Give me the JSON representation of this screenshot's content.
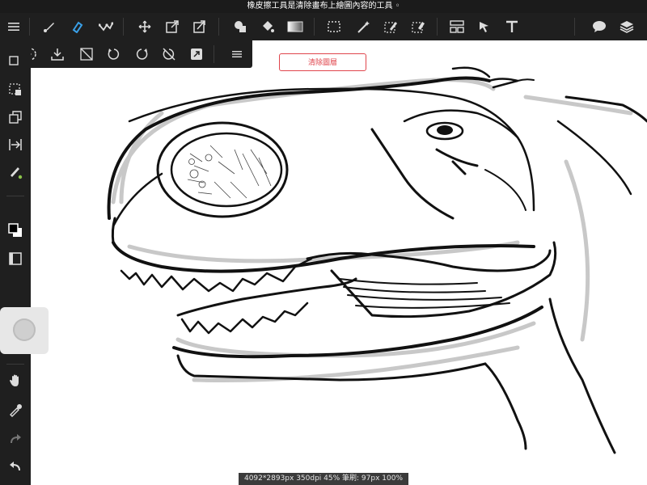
{
  "window": {
    "title": "橡皮擦工具是清除畫布上繪圖內容的工具 ◦"
  },
  "toolbar": {
    "items": [
      "menu-icon",
      "brush-icon",
      "eraser-icon",
      "stroke-icon",
      "move-icon",
      "transform-icon",
      "distort-icon",
      "shape-icon",
      "fill-icon",
      "gradient-icon",
      "rect-select-icon",
      "magic-wand-icon",
      "pen-select-icon",
      "erase-select-icon",
      "layout-icon",
      "select-arrow-icon",
      "text-icon",
      "comment-icon",
      "layers-icon"
    ],
    "active": "eraser-icon"
  },
  "subbar": {
    "items": [
      "lasso-icon",
      "import-icon",
      "flip-icon",
      "rotate-left-icon",
      "rotate-right-icon",
      "no-rotate-icon",
      "resize-icon",
      "more-icon"
    ]
  },
  "actions": {
    "clear_layer": "清除圖層"
  },
  "leftbar": {
    "items": [
      "layer-move-icon",
      "selection-icon",
      "copy-icon",
      "align-icon",
      "color-brush-icon",
      "color-swatch-icon",
      "canvas-icon",
      "hand-icon",
      "eyedropper-icon",
      "redo-icon",
      "undo-icon"
    ]
  },
  "status": {
    "text": "4092*2893px 350dpi 45% 筆刷: 97px 100%"
  },
  "colors": {
    "toolbar_bg": "#1f1f1f",
    "accent": "#3aa0e8",
    "danger": "#e0454c"
  }
}
